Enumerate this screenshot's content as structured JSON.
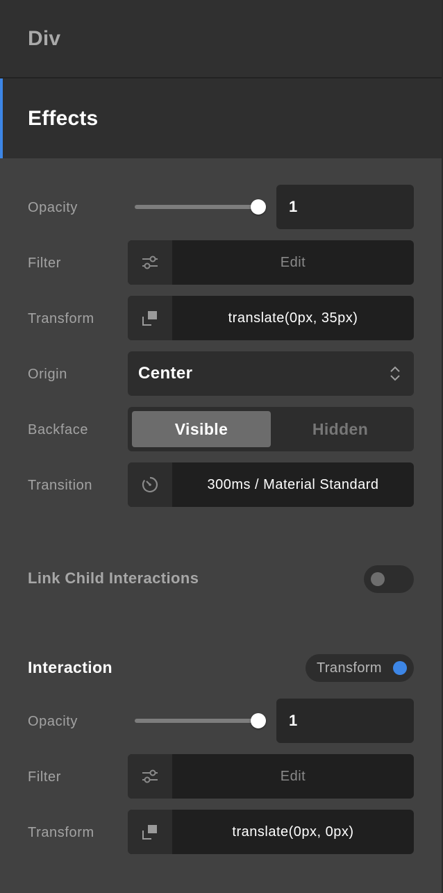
{
  "sections": {
    "div_title": "Div",
    "effects_title": "Effects"
  },
  "effects": {
    "opacity": {
      "label": "Opacity",
      "value": "1",
      "slider_fraction": 1.0
    },
    "filter": {
      "label": "Filter",
      "value": "Edit",
      "icon": "sliders-icon"
    },
    "transform": {
      "label": "Transform",
      "value": "translate(0px, 35px)",
      "icon": "transform-icon"
    },
    "origin": {
      "label": "Origin",
      "value": "Center",
      "icon": "chevron-updown-icon"
    },
    "backface": {
      "label": "Backface",
      "options": [
        "Visible",
        "Hidden"
      ],
      "selected": "Visible"
    },
    "transition": {
      "label": "Transition",
      "value": "300ms / Material Standard",
      "icon": "timer-icon"
    }
  },
  "link_child": {
    "label": "Link Child Interactions",
    "enabled": false
  },
  "interaction": {
    "title": "Interaction",
    "mode_pill": "Transform",
    "opacity": {
      "label": "Opacity",
      "value": "1",
      "slider_fraction": 1.0
    },
    "filter": {
      "label": "Filter",
      "value": "Edit",
      "icon": "sliders-icon"
    },
    "transform": {
      "label": "Transform",
      "value": "translate(0px, 0px)",
      "icon": "transform-icon"
    }
  },
  "colors": {
    "accent": "#3d86e6",
    "panel_bg": "#414141",
    "header_bg": "#2f2f2f",
    "field_bg": "#1f1f1f"
  }
}
